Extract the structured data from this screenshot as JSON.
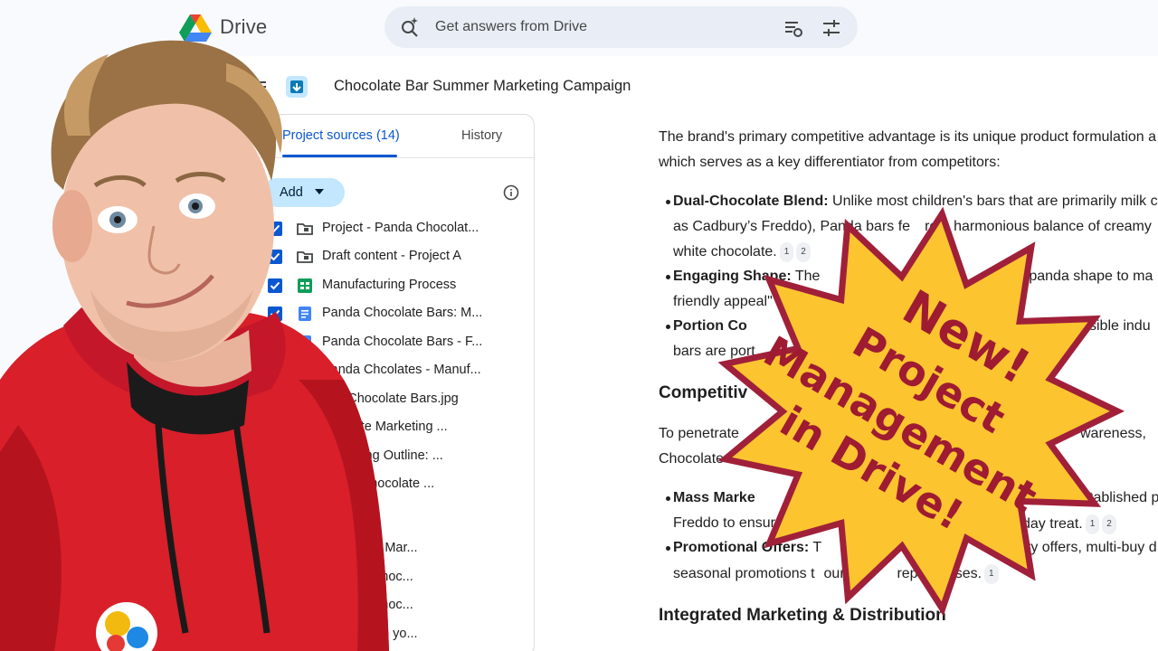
{
  "app": {
    "title": "Drive"
  },
  "search": {
    "placeholder": "Get answers from Drive"
  },
  "project": {
    "title": "Chocolate Bar Summer Marketing Campaign"
  },
  "sources": {
    "tabs": [
      {
        "label": "Project sources (14)"
      },
      {
        "label": "History"
      }
    ],
    "add_label": "Add",
    "items": [
      {
        "label": "Project - Panda Chocolat...",
        "icon": "folder-icon",
        "checked": true
      },
      {
        "label": "Draft content - Project A",
        "icon": "folder-icon",
        "checked": true
      },
      {
        "label": "Manufacturing Process",
        "icon": "sheets-icon",
        "checked": true
      },
      {
        "label": "Panda Chocolate Bars: M...",
        "icon": "docs-icon",
        "checked": true
      },
      {
        "label": "Panda Chocolate Bars - F...",
        "icon": "docs-icon",
        "checked": true
      },
      {
        "label": "Panda Chcolates - Manuf...",
        "icon": "sheets-icon",
        "checked": true
      },
      {
        "label": "nda Chocolate Bars.jpg",
        "icon": "image-icon",
        "checked": true
      },
      {
        "label": "hocolate Marketing ...",
        "icon": "docs-icon",
        "checked": true
      },
      {
        "label": "Marketing Outline: ...",
        "icon": "docs-icon",
        "checked": true
      },
      {
        "label": "cused Chocolate ...",
        "icon": "docs-icon",
        "checked": true
      },
      {
        "label": "colate Bar Mar...",
        "icon": "docs-icon",
        "checked": true
      },
      {
        "label": "r Panda Choc...",
        "icon": "docs-icon",
        "checked": true
      },
      {
        "label": "r Panda Choc...",
        "icon": "docs-icon",
        "checked": true
      },
      {
        "label": "shared with yo...",
        "icon": "folder-icon",
        "checked": true
      }
    ]
  },
  "doc": {
    "intro_line1": "The brand's primary competitive advantage is its unique product formulation a",
    "intro_line2": "which serves as a key differentiator from competitors:",
    "b1_title": "Dual-Chocolate Blend:",
    "b1_line1": "Unlike most children's bars that are primarily milk ch",
    "b1_line2": "as Cadbury’s Freddo), Panda bars fe",
    "b1_line2b": "re a harmonious balance of creamy",
    "b1_line3": "white chocolate.",
    "b2_title": "Engaging Shape:",
    "b2_line1a": "The",
    "b2_line1b": "e panda shape to ma",
    "b2_line2": "friendly appeal\" and v",
    "b3_title": "Portion Co",
    "b3_line1b": "ssible indu",
    "b3_line2": "bars are port",
    "h1": "Competitiv",
    "p2_line1a": "To penetrate",
    "p2_line1b": "wareness,",
    "p2_line2": "Chocolate Bars w",
    "b4_title": "Mass Marke",
    "b4_line1b": "stablished p",
    "b4_line2a": "Freddo to ensure it is",
    "b4_line2b": "day treat.",
    "b5_title": "Promotional Offers:",
    "b5_line1a": "T",
    "b5_line1b": "ry offers, multi-buy d",
    "b5_line2a": "seasonal promotions t",
    "b5_line2b": "ourag",
    "b5_line2c": "rep",
    "b5_line2d": "rchases.",
    "h2": "Integrated Marketing & Distribution",
    "cite1": "1",
    "cite2": "2"
  },
  "overlay": {
    "line1": "New!",
    "line2": "Project",
    "line3": "Management",
    "line4": "in Drive!",
    "fill": "#fcc42f",
    "stroke": "#a0203a",
    "text_color": "#9e1b32"
  }
}
